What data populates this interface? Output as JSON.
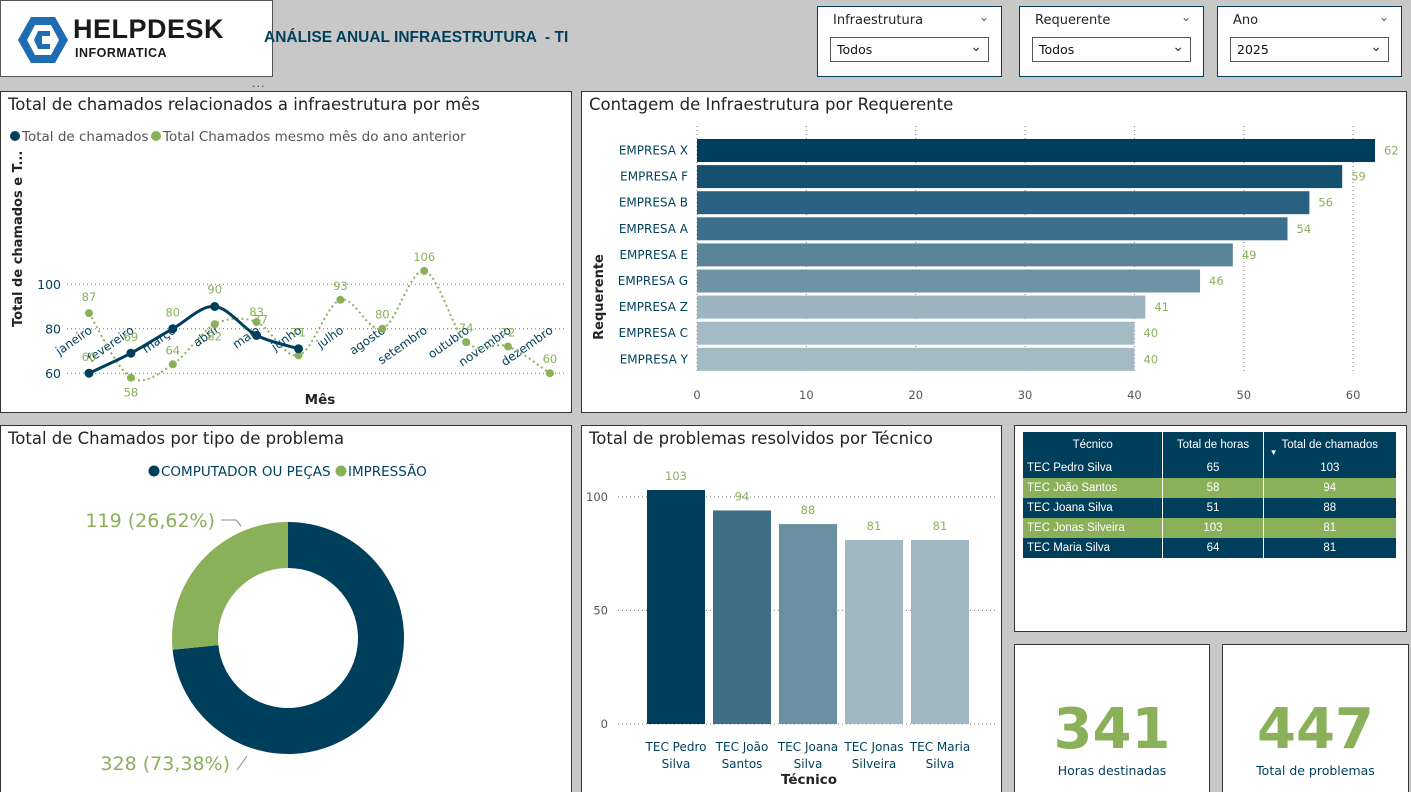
{
  "header": {
    "logo_main": "HELPDESK",
    "logo_sub": "INFORMATICA",
    "title": "ANÁLISE ANUAL INFRAESTRUTURA  - TI",
    "more_icon": "ellipsis-icon"
  },
  "slicers": [
    {
      "label": "Infraestrutura",
      "value": "Todos"
    },
    {
      "label": "Requerente",
      "value": "Todos"
    },
    {
      "label": "Ano",
      "value": "2025"
    }
  ],
  "line_panel": {
    "title": "Total de chamados relacionados a infraestrutura por mês",
    "legend": [
      "Total de chamados",
      "Total Chamados mesmo mês do ano anterior"
    ],
    "ylabel": "Total de chamados e T...",
    "xlabel": "Mês"
  },
  "bar_panel": {
    "title": "Contagem de Infraestrutura por Requerente",
    "ylabel": "Requerente"
  },
  "donut_panel": {
    "title": "Total de Chamados por tipo de problema",
    "legend": [
      "COMPUTADOR OU PEÇAS",
      "IMPRESSÃO"
    ],
    "label_green": "119 (26,62%)",
    "label_navy": "328 (73,38%)"
  },
  "col_panel": {
    "title": "Total de problemas resolvidos por Técnico",
    "xlabel": "Técnico"
  },
  "table": {
    "columns": [
      "Técnico",
      "Total de horas",
      "Total de chamados"
    ],
    "sort_icon": "sort-desc-icon",
    "rows": [
      [
        "TEC Pedro Silva",
        "65",
        "103"
      ],
      [
        "TEC João Santos",
        "58",
        "94"
      ],
      [
        "TEC Joana Silva",
        "51",
        "88"
      ],
      [
        "TEC Jonas Silveira",
        "103",
        "81"
      ],
      [
        "TEC Maria Silva",
        "64",
        "81"
      ]
    ]
  },
  "kpis": [
    {
      "value": "341",
      "caption": "Horas destinadas"
    },
    {
      "value": "447",
      "caption": "Total de problemas"
    }
  ],
  "colors": {
    "navy": "#003f5c",
    "green": "#8ab15a"
  },
  "chart_data": [
    {
      "type": "line",
      "x": [
        "janeiro",
        "fevereiro",
        "março",
        "abril",
        "maio",
        "junho",
        "julho",
        "agosto",
        "setembro",
        "outubro",
        "novembro",
        "dezembro"
      ],
      "series": [
        {
          "name": "Total de chamados",
          "values": [
            60,
            69,
            80,
            90,
            77,
            71,
            null,
            null,
            null,
            null,
            null,
            null
          ]
        },
        {
          "name": "Total Chamados mesmo mês do ano anterior",
          "values": [
            87,
            58,
            64,
            82,
            83,
            68,
            93,
            80,
            106,
            74,
            72,
            60
          ]
        }
      ],
      "labels_total": [
        "60",
        "69",
        "80",
        "90",
        "",
        "71"
      ],
      "labels_prev": [
        "87",
        "58",
        "64",
        "82",
        "83",
        "",
        "93",
        "80",
        "106",
        "74",
        "72",
        "60"
      ],
      "label_maio_extra": "77",
      "ylim": [
        52,
        110
      ],
      "yticks": [
        "60",
        "80",
        "100"
      ]
    },
    {
      "type": "bar",
      "categories": [
        "EMPRESA X",
        "EMPRESA F",
        "EMPRESA B",
        "EMPRESA A",
        "EMPRESA E",
        "EMPRESA G",
        "EMPRESA Z",
        "EMPRESA C",
        "EMPRESA Y"
      ],
      "values": [
        62,
        59,
        56,
        54,
        49,
        46,
        41,
        40,
        40
      ],
      "xticks": [
        "0",
        "10",
        "20",
        "30",
        "40",
        "50",
        "60"
      ],
      "xlim": [
        0,
        62
      ]
    },
    {
      "type": "pie",
      "categories": [
        "COMPUTADOR OU PEÇAS",
        "IMPRESSÃO"
      ],
      "values": [
        328,
        119
      ]
    },
    {
      "type": "bar",
      "categories": [
        "TEC Pedro Silva",
        "TEC João Santos",
        "TEC Joana Silva",
        "TEC Jonas Silveira",
        "TEC Maria Silva"
      ],
      "values": [
        103,
        94,
        88,
        81,
        81
      ],
      "yticks": [
        "0",
        "50",
        "100"
      ],
      "ylim": [
        0,
        103
      ]
    }
  ]
}
